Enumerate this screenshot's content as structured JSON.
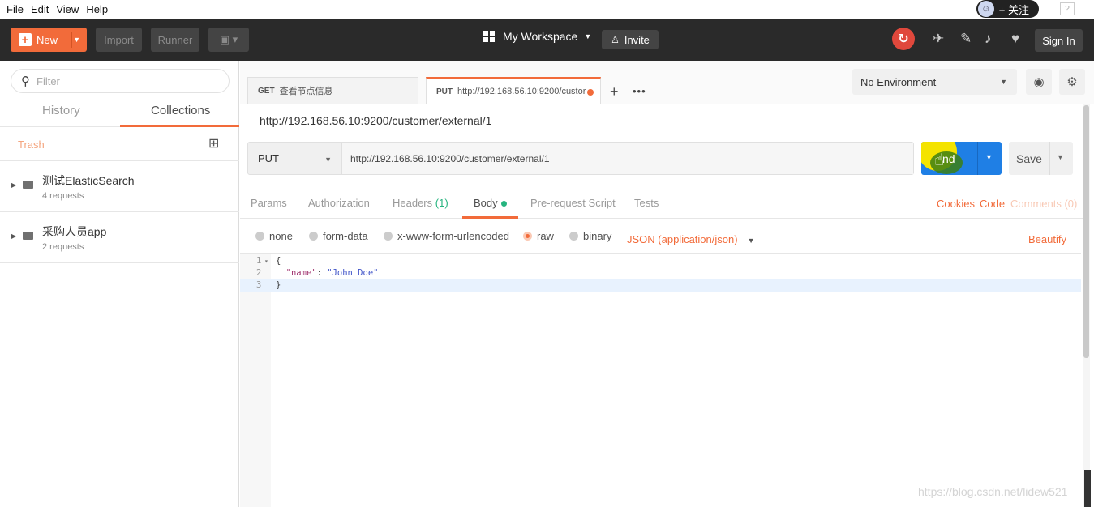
{
  "menubar": {
    "items": [
      "File",
      "Edit",
      "View",
      "Help"
    ],
    "overlay_label": "+ 关注",
    "help_box": "?"
  },
  "header": {
    "new_label": "New",
    "import_label": "Import",
    "runner_label": "Runner",
    "workspace_label": "My Workspace",
    "invite_label": "Invite",
    "signin_label": "Sign In"
  },
  "sidebar": {
    "filter_placeholder": "Filter",
    "tabs": {
      "history": "History",
      "collections": "Collections"
    },
    "trash_label": "Trash",
    "collections": [
      {
        "name": "测试ElasticSearch",
        "count": "4 requests"
      },
      {
        "name": "采购人员app",
        "count": "2 requests"
      }
    ]
  },
  "tabs": [
    {
      "method": "GET",
      "title": "查看节点信息"
    },
    {
      "method": "PUT",
      "title": "http://192.168.56.10:9200/custor"
    }
  ],
  "environment": {
    "selected": "No Environment"
  },
  "request": {
    "title": "http://192.168.56.10:9200/customer/external/1",
    "method": "PUT",
    "url": "http://192.168.56.10:9200/customer/external/1",
    "send_label": "nd",
    "save_label": "Save"
  },
  "sub_tabs": {
    "params": "Params",
    "authorization": "Authorization",
    "headers": "Headers",
    "headers_count": "(1)",
    "body": "Body",
    "prerequest": "Pre-request Script",
    "tests": "Tests",
    "cookies": "Cookies",
    "code": "Code",
    "comments": "Comments (0)"
  },
  "body_options": {
    "none": "none",
    "form_data": "form-data",
    "urlencoded": "x-www-form-urlencoded",
    "raw": "raw",
    "binary": "binary",
    "selected_type": "JSON (application/json)",
    "beautify": "Beautify"
  },
  "editor": {
    "lines": [
      {
        "n": "1",
        "text": "{"
      },
      {
        "n": "2",
        "key": "\"name\"",
        "sep": ": ",
        "value": "\"John Doe\""
      },
      {
        "n": "3",
        "text": "}"
      }
    ]
  },
  "watermark": "https://blog.csdn.net/lidew521",
  "colors": {
    "accent": "#f26b3a",
    "send": "#1f7fe5",
    "header_bg": "#2a2a2a",
    "green": "#26b47f"
  },
  "icons": [
    "search-icon",
    "new-collection-icon",
    "folder-icon",
    "sync-icon",
    "satellite-icon",
    "wrench-icon",
    "bell-icon",
    "heart-icon",
    "eye-icon",
    "gear-icon",
    "grid-icon",
    "invite-user-icon"
  ]
}
